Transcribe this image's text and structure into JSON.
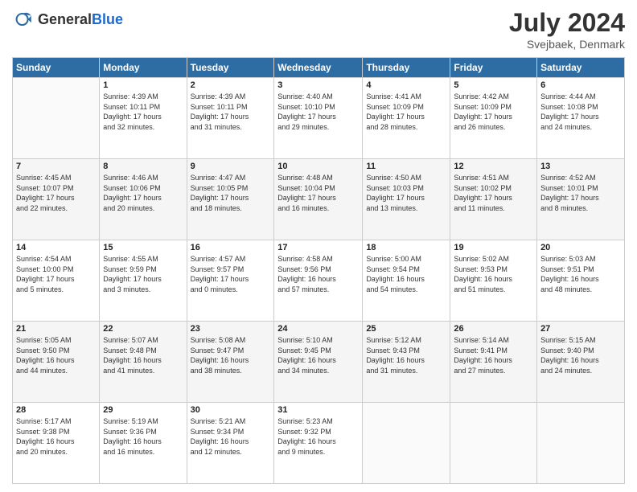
{
  "header": {
    "logo_general": "General",
    "logo_blue": "Blue",
    "month_title": "July 2024",
    "location": "Svejbaek, Denmark"
  },
  "days_of_week": [
    "Sunday",
    "Monday",
    "Tuesday",
    "Wednesday",
    "Thursday",
    "Friday",
    "Saturday"
  ],
  "weeks": [
    [
      {
        "day": "",
        "info": ""
      },
      {
        "day": "1",
        "info": "Sunrise: 4:39 AM\nSunset: 10:11 PM\nDaylight: 17 hours\nand 32 minutes."
      },
      {
        "day": "2",
        "info": "Sunrise: 4:39 AM\nSunset: 10:11 PM\nDaylight: 17 hours\nand 31 minutes."
      },
      {
        "day": "3",
        "info": "Sunrise: 4:40 AM\nSunset: 10:10 PM\nDaylight: 17 hours\nand 29 minutes."
      },
      {
        "day": "4",
        "info": "Sunrise: 4:41 AM\nSunset: 10:09 PM\nDaylight: 17 hours\nand 28 minutes."
      },
      {
        "day": "5",
        "info": "Sunrise: 4:42 AM\nSunset: 10:09 PM\nDaylight: 17 hours\nand 26 minutes."
      },
      {
        "day": "6",
        "info": "Sunrise: 4:44 AM\nSunset: 10:08 PM\nDaylight: 17 hours\nand 24 minutes."
      }
    ],
    [
      {
        "day": "7",
        "info": "Sunrise: 4:45 AM\nSunset: 10:07 PM\nDaylight: 17 hours\nand 22 minutes."
      },
      {
        "day": "8",
        "info": "Sunrise: 4:46 AM\nSunset: 10:06 PM\nDaylight: 17 hours\nand 20 minutes."
      },
      {
        "day": "9",
        "info": "Sunrise: 4:47 AM\nSunset: 10:05 PM\nDaylight: 17 hours\nand 18 minutes."
      },
      {
        "day": "10",
        "info": "Sunrise: 4:48 AM\nSunset: 10:04 PM\nDaylight: 17 hours\nand 16 minutes."
      },
      {
        "day": "11",
        "info": "Sunrise: 4:50 AM\nSunset: 10:03 PM\nDaylight: 17 hours\nand 13 minutes."
      },
      {
        "day": "12",
        "info": "Sunrise: 4:51 AM\nSunset: 10:02 PM\nDaylight: 17 hours\nand 11 minutes."
      },
      {
        "day": "13",
        "info": "Sunrise: 4:52 AM\nSunset: 10:01 PM\nDaylight: 17 hours\nand 8 minutes."
      }
    ],
    [
      {
        "day": "14",
        "info": "Sunrise: 4:54 AM\nSunset: 10:00 PM\nDaylight: 17 hours\nand 5 minutes."
      },
      {
        "day": "15",
        "info": "Sunrise: 4:55 AM\nSunset: 9:59 PM\nDaylight: 17 hours\nand 3 minutes."
      },
      {
        "day": "16",
        "info": "Sunrise: 4:57 AM\nSunset: 9:57 PM\nDaylight: 17 hours\nand 0 minutes."
      },
      {
        "day": "17",
        "info": "Sunrise: 4:58 AM\nSunset: 9:56 PM\nDaylight: 16 hours\nand 57 minutes."
      },
      {
        "day": "18",
        "info": "Sunrise: 5:00 AM\nSunset: 9:54 PM\nDaylight: 16 hours\nand 54 minutes."
      },
      {
        "day": "19",
        "info": "Sunrise: 5:02 AM\nSunset: 9:53 PM\nDaylight: 16 hours\nand 51 minutes."
      },
      {
        "day": "20",
        "info": "Sunrise: 5:03 AM\nSunset: 9:51 PM\nDaylight: 16 hours\nand 48 minutes."
      }
    ],
    [
      {
        "day": "21",
        "info": "Sunrise: 5:05 AM\nSunset: 9:50 PM\nDaylight: 16 hours\nand 44 minutes."
      },
      {
        "day": "22",
        "info": "Sunrise: 5:07 AM\nSunset: 9:48 PM\nDaylight: 16 hours\nand 41 minutes."
      },
      {
        "day": "23",
        "info": "Sunrise: 5:08 AM\nSunset: 9:47 PM\nDaylight: 16 hours\nand 38 minutes."
      },
      {
        "day": "24",
        "info": "Sunrise: 5:10 AM\nSunset: 9:45 PM\nDaylight: 16 hours\nand 34 minutes."
      },
      {
        "day": "25",
        "info": "Sunrise: 5:12 AM\nSunset: 9:43 PM\nDaylight: 16 hours\nand 31 minutes."
      },
      {
        "day": "26",
        "info": "Sunrise: 5:14 AM\nSunset: 9:41 PM\nDaylight: 16 hours\nand 27 minutes."
      },
      {
        "day": "27",
        "info": "Sunrise: 5:15 AM\nSunset: 9:40 PM\nDaylight: 16 hours\nand 24 minutes."
      }
    ],
    [
      {
        "day": "28",
        "info": "Sunrise: 5:17 AM\nSunset: 9:38 PM\nDaylight: 16 hours\nand 20 minutes."
      },
      {
        "day": "29",
        "info": "Sunrise: 5:19 AM\nSunset: 9:36 PM\nDaylight: 16 hours\nand 16 minutes."
      },
      {
        "day": "30",
        "info": "Sunrise: 5:21 AM\nSunset: 9:34 PM\nDaylight: 16 hours\nand 12 minutes."
      },
      {
        "day": "31",
        "info": "Sunrise: 5:23 AM\nSunset: 9:32 PM\nDaylight: 16 hours\nand 9 minutes."
      },
      {
        "day": "",
        "info": ""
      },
      {
        "day": "",
        "info": ""
      },
      {
        "day": "",
        "info": ""
      }
    ]
  ]
}
